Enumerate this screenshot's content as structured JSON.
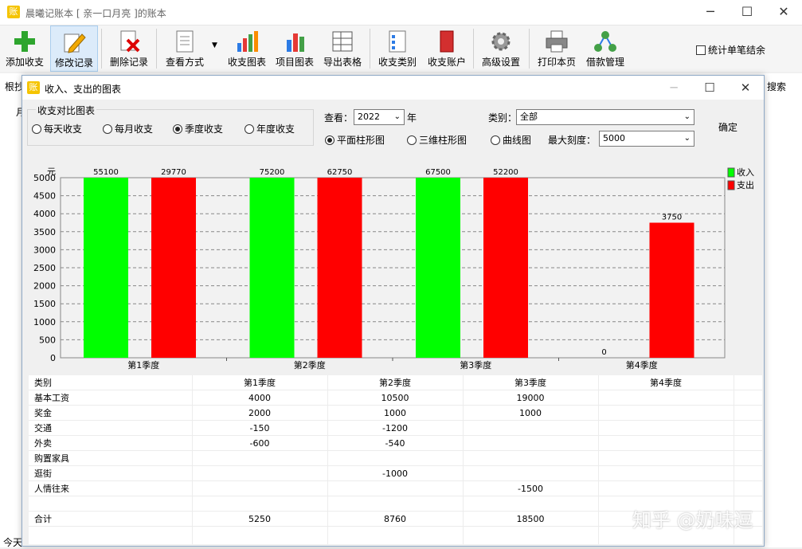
{
  "window": {
    "title": "晨曦记账本   [ 亲一口月亮 ]的账本",
    "icon_text": "账"
  },
  "toolbar": [
    {
      "label": "添加收支",
      "icon": "add-plus-icon"
    },
    {
      "label": "修改记录",
      "icon": "edit-pencil-icon"
    },
    {
      "label": "删除记录",
      "icon": "delete-doc-icon"
    },
    {
      "label": "查看方式",
      "icon": "view-doc-icon"
    },
    {
      "label": "收支图表",
      "icon": "bar-chart-icon"
    },
    {
      "label": "项目图表",
      "icon": "project-chart-icon"
    },
    {
      "label": "导出表格",
      "icon": "export-table-icon"
    },
    {
      "label": "收支类别",
      "icon": "category-list-icon"
    },
    {
      "label": "收支账户",
      "icon": "account-book-icon"
    },
    {
      "label": "高级设置",
      "icon": "gear-icon"
    },
    {
      "label": "打印本页",
      "icon": "printer-icon"
    },
    {
      "label": "借款管理",
      "icon": "network-icon"
    }
  ],
  "stat_checkbox": "统计单笔结余",
  "background": {
    "left_text": "根抄",
    "right_text": "搜索",
    "bottom_text": "今天",
    "row_text": "月"
  },
  "dialog": {
    "title": "收入、支出的图表",
    "group_label": "收支对比图表",
    "period_options": [
      "每天收支",
      "每月收支",
      "季度收支",
      "年度收支"
    ],
    "period_selected": 2,
    "view_label": "查看：",
    "year_value": "2022",
    "year_suffix": "年",
    "category_label": "类别：",
    "category_value": "全部",
    "confirm_label": "确定",
    "chart_types": [
      "平面柱形图",
      "三维柱形图",
      "曲线图"
    ],
    "chart_type_selected": 0,
    "max_scale_label": "最大刻度：",
    "max_scale_value": "5000"
  },
  "chart_data": {
    "type": "bar",
    "ylabel": "元",
    "ylim": [
      0,
      5000
    ],
    "yticks": [
      0,
      500,
      1000,
      1500,
      2000,
      2500,
      3000,
      3500,
      4000,
      4500,
      5000
    ],
    "categories": [
      "第1季度",
      "第2季度",
      "第3季度",
      "第4季度"
    ],
    "series": [
      {
        "name": "收入",
        "color": "#00ff00",
        "values": [
          55100,
          75200,
          67500,
          0
        ]
      },
      {
        "name": "支出",
        "color": "#ff0000",
        "values": [
          29770,
          62750,
          52200,
          3750
        ]
      }
    ],
    "grid": true,
    "legend": "top-right"
  },
  "table": {
    "headers": [
      "类别",
      "第1季度",
      "第2季度",
      "第3季度",
      "第4季度"
    ],
    "rows": [
      [
        "基本工资",
        "4000",
        "10500",
        "19000",
        ""
      ],
      [
        "奖金",
        "2000",
        "1000",
        "1000",
        ""
      ],
      [
        "交通",
        "-150",
        "-1200",
        "",
        ""
      ],
      [
        "外卖",
        "-600",
        "-540",
        "",
        ""
      ],
      [
        "购置家具",
        "",
        "",
        "",
        ""
      ],
      [
        "逛街",
        "",
        "-1000",
        "",
        ""
      ],
      [
        "人情往来",
        "",
        "",
        "-1500",
        ""
      ],
      [
        "",
        "",
        "",
        "",
        ""
      ],
      [
        "合计",
        "5250",
        "8760",
        "18500",
        ""
      ]
    ]
  },
  "watermark": "知乎 @奶味逗"
}
